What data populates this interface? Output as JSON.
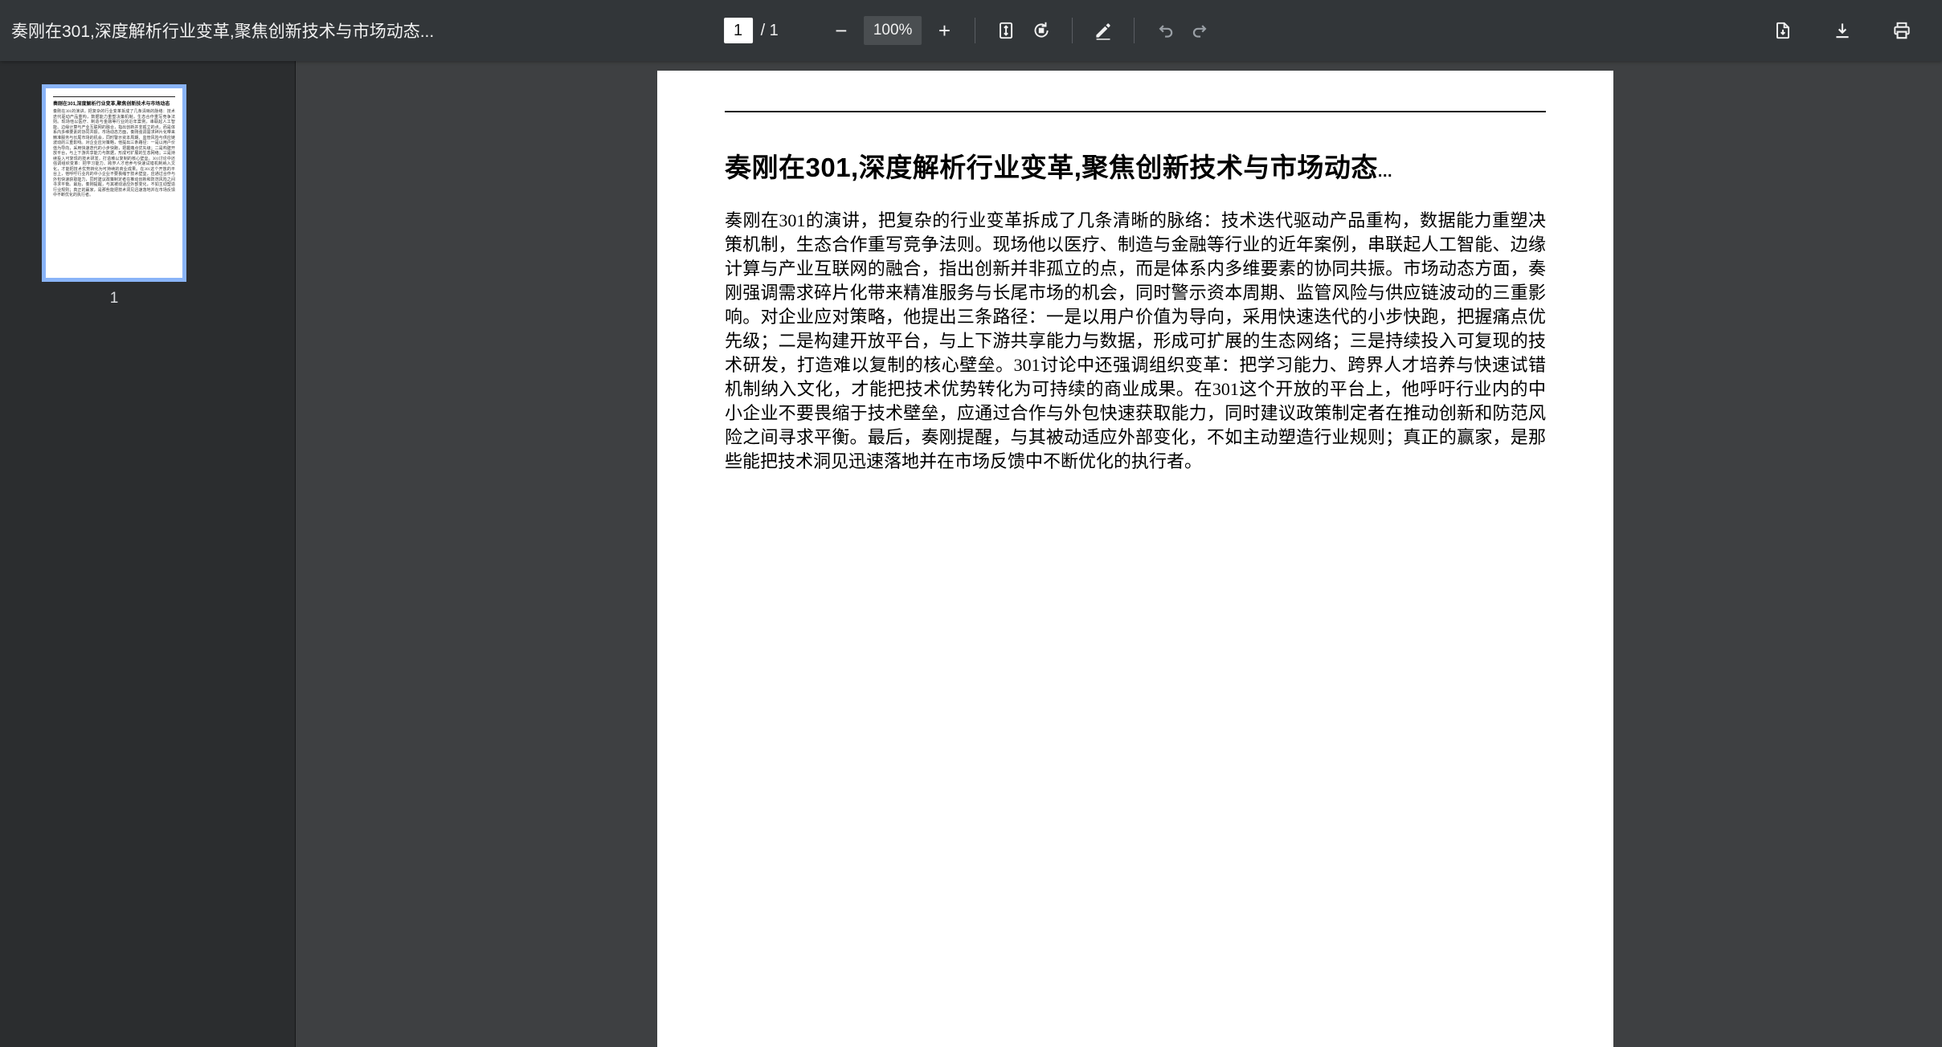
{
  "toolbar": {
    "title": "奏刚在301,深度解析行业变革,聚焦创新技术与市场动态...",
    "page": {
      "current": "1",
      "total_label": "/ 1"
    },
    "zoom": {
      "out": "−",
      "level": "100%",
      "in": "+"
    },
    "icon_names": [
      "fit-to-page",
      "rotate",
      "annotate-pen",
      "undo",
      "redo",
      "save-file",
      "download",
      "print"
    ]
  },
  "sidebar": {
    "page1_label": "1"
  },
  "document": {
    "title": "奏刚在301,深度解析行业变革,聚焦创新技术与市场动态",
    "title_ellipsis": "...",
    "body": "奏刚在301的演讲，把复杂的行业变革拆成了几条清晰的脉络：技术迭代驱动产品重构，数据能力重塑决策机制，生态合作重写竞争法则。现场他以医疗、制造与金融等行业的近年案例，串联起人工智能、边缘计算与产业互联网的融合，指出创新并非孤立的点，而是体系内多维要素的协同共振。市场动态方面，奏刚强调需求碎片化带来精准服务与长尾市场的机会，同时警示资本周期、监管风险与供应链波动的三重影响。对企业应对策略，他提出三条路径：一是以用户价值为导向，采用快速迭代的小步快跑，把握痛点优先级；二是构建开放平台，与上下游共享能力与数据，形成可扩展的生态网络；三是持续投入可复现的技术研发，打造难以复制的核心壁垒。301讨论中还强调组织变革：把学习能力、跨界人才培养与快速试错机制纳入文化，才能把技术优势转化为可持续的商业成果。在301这个开放的平台上，他呼吁行业内的中小企业不要畏缩于技术壁垒，应通过合作与外包快速获取能力，同时建议政策制定者在推动创新和防范风险之间寻求平衡。最后，奏刚提醒，与其被动适应外部变化，不如主动塑造行业规则；真正的赢家，是那些能把技术洞见迅速落地并在市场反馈中不断优化的执行者。"
  },
  "colors": {
    "toolbar_bg": "#323639",
    "sidebar_bg": "#2b2d2f",
    "canvas_bg": "#3e4042",
    "thumbnail_selected_border": "#8ab4f8",
    "page_bg": "#ffffff"
  }
}
